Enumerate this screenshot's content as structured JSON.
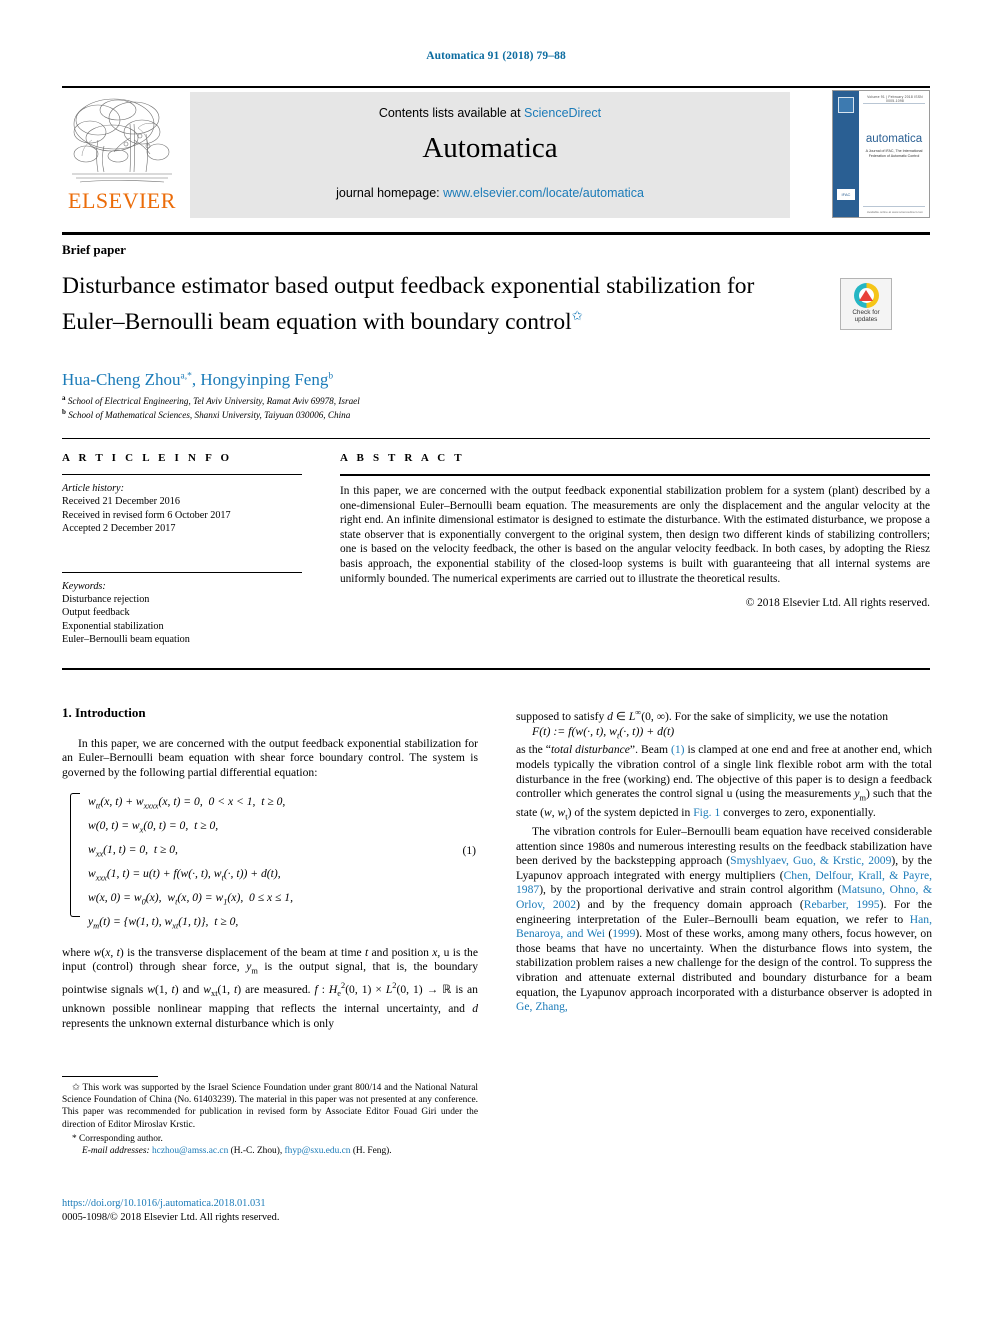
{
  "running_head": "Automatica 91 (2018) 79–88",
  "masthead": {
    "publisher_logo_text": "ELSEVIER",
    "contents_prefix": "Contents lists available at ",
    "contents_link": "ScienceDirect",
    "journal_title": "Automatica",
    "homepage_prefix": "journal homepage: ",
    "homepage_link": "www.elsevier.com/locate/automatica",
    "cover": {
      "volume_line": "Volume 91  |  February 2018    ISSN 0005-1098",
      "title": "automatica",
      "subtitle": "A Journal of IFAC, The International Federation of Automatic Control",
      "ifac_badge": "IFAC",
      "bottom_line": "Available online at www.sciencedirect.com"
    }
  },
  "article": {
    "type_label": "Brief paper",
    "title": "Disturbance estimator based output feedback exponential stabilization for Euler–Bernoulli beam equation with boundary control",
    "title_footnote_marker": "✩",
    "crossmark": {
      "line1": "Check for",
      "line2": "updates"
    },
    "authors": "Hua-Cheng Zhou",
    "author1_sup": "a,*",
    "author2": "Hongyinping Feng",
    "author2_sup": "b",
    "affiliations": [
      {
        "marker": "a",
        "text": "School of Electrical Engineering, Tel Aviv University, Ramat Aviv 69978, Israel"
      },
      {
        "marker": "b",
        "text": "School of Mathematical Sciences, Shanxi University, Taiyuan 030006, China"
      }
    ]
  },
  "article_info": {
    "heading": "A R T I C L E   I N F O",
    "history_label": "Article history:",
    "history": [
      "Received 21 December 2016",
      "Received in revised form 6 October 2017",
      "Accepted 2 December 2017"
    ],
    "keywords_label": "Keywords:",
    "keywords": [
      "Disturbance rejection",
      "Output feedback",
      "Exponential stabilization",
      "Euler–Bernoulli beam equation"
    ]
  },
  "abstract": {
    "heading": "A B S T R A C T",
    "text": "In this paper, we are concerned with the output feedback exponential stabilization problem for a system (plant) described by a one-dimensional Euler–Bernoulli beam equation. The measurements are only the displacement and the angular velocity at the right end. An infinite dimensional estimator is designed to estimate the disturbance. With the estimated disturbance, we propose a state observer that is exponentially convergent to the original system, then design two different kinds of stabilizing controllers; one is based on the velocity feedback, the other is based on the angular velocity feedback. In both cases, by adopting the Riesz basis approach, the exponential stability of the closed-loop systems is built with guaranteeing that all internal systems are uniformly bounded. The numerical experiments are carried out to illustrate the theoretical results.",
    "copyright": "© 2018 Elsevier Ltd. All rights reserved."
  },
  "body": {
    "section_heading": "1. Introduction",
    "left_para1": "In this paper, we are concerned with the output feedback exponential stabilization for an Euler–Bernoulli beam equation with shear force boundary control. The system is governed by the following partial differential equation:",
    "equation": {
      "number": "(1)",
      "lines": [
        "w_tt(x, t) + w_xxxx(x, t) = 0,  0 < x < 1,  t ≥ 0,",
        "w(0, t) = w_x(0, t) = 0,  t ≥ 0,",
        "w_xx(1, t) = 0,  t ≥ 0,",
        "w_xxx(1, t) = u(t) + f(w(·, t), w_t(·, t)) + d(t),",
        "w(x, 0) = w_0(x),  w_t(x, 0) = w_1(x),  0 ≤ x ≤ 1,",
        "y_m(t) = {w(1, t), w_xt(1, t)},  t ≥ 0,"
      ]
    },
    "left_para2_a": "where ",
    "left_para2": "where w(x, t) is the transverse displacement of the beam at time t and position x, u is the input (control) through shear force, y_m is the output signal, that is, the boundary pointwise signals w(1, t) and w_xt(1, t) are measured. f : H²_e(0, 1) × L²(0, 1) → ℝ is an unknown possible nonlinear mapping that reflects the internal uncertainty, and d represents the unknown external disturbance which is only",
    "right_para1": "supposed to satisfy d ∈ L^∞(0, ∞). For the sake of simplicity, we use the notation",
    "right_eq": "F(t) := f(w(·, t), w_t(·, t)) + d(t)",
    "right_para2": "as the “total disturbance”. Beam (1) is clamped at one end and free at another end, which models typically the vibration control of a single link flexible robot arm with the total disturbance in the free (working) end. The objective of this paper is to design a feedback controller which generates the control signal u (using the measurements y_m) such that the state (w, w_t) of the system depicted in Fig. 1 converges to zero, exponentially.",
    "right_para3": "The vibration controls for Euler–Bernoulli beam equation have received considerable attention since 1980s and numerous interesting results on the feedback stabilization have been derived by the backstepping approach (Smyshlyaev, Guo, & Krstic, 2009), by the Lyapunov approach integrated with energy multipliers (Chen, Delfour, Krall, & Payre, 1987), by the proportional derivative and strain control algorithm (Matsuno, Ohno, & Orlov, 2002) and by the frequency domain approach (Rebarber, 1995). For the engineering interpretation of the Euler–Bernoulli beam equation, we refer to Han, Benaroya, and Wei (1999). Most of these works, among many others, focus however, on those beams that have no uncertainty. When the disturbance flows into system, the stabilization problem raises a new challenge for the design of the control. To suppress the vibration and attenuate external distributed and boundary disturbance for a beam equation, the Lyapunov approach incorporated with a disturbance observer is adopted in Ge, Zhang,",
    "citations": {
      "fig1": "Fig. 1",
      "eq1": "(1)",
      "c1": "Smyshlyaev, Guo, & Krstic, 2009",
      "c2": "Chen, Delfour, Krall, & Payre, 1987",
      "c3": "Matsuno, Ohno, & Orlov, 2002",
      "c4": "Rebarber, 1995",
      "c5": "Han, Benaroya, and Wei",
      "c5year": "1999",
      "c6": "Ge, Zhang,"
    }
  },
  "footnotes": {
    "star_marker": "✩",
    "funding": "This work was supported by the Israel Science Foundation under grant 800/14 and the National Natural Science Foundation of China (No. 61403239). The material in this paper was not presented at any conference. This paper was recommended for publication in revised form by Associate Editor Fouad Giri under the direction of Editor Miroslav Krstic.",
    "corresponding_marker": "*",
    "corresponding": "Corresponding author.",
    "email_label": "E-mail addresses:",
    "email1": "hczhou@amss.ac.cn",
    "email1_who": "(H.-C. Zhou)",
    "email2": "fhyp@sxu.edu.cn",
    "email2_who": "(H. Feng).",
    "doi": "https://doi.org/10.1016/j.automatica.2018.01.031",
    "issn_line_a": "0005-1098/",
    "issn_line_b": "© 2018 Elsevier Ltd. All rights reserved."
  },
  "colors": {
    "link": "#1b7bb8",
    "elsevier_orange": "#eb6c09",
    "cover_blue": "#2a5f93"
  }
}
